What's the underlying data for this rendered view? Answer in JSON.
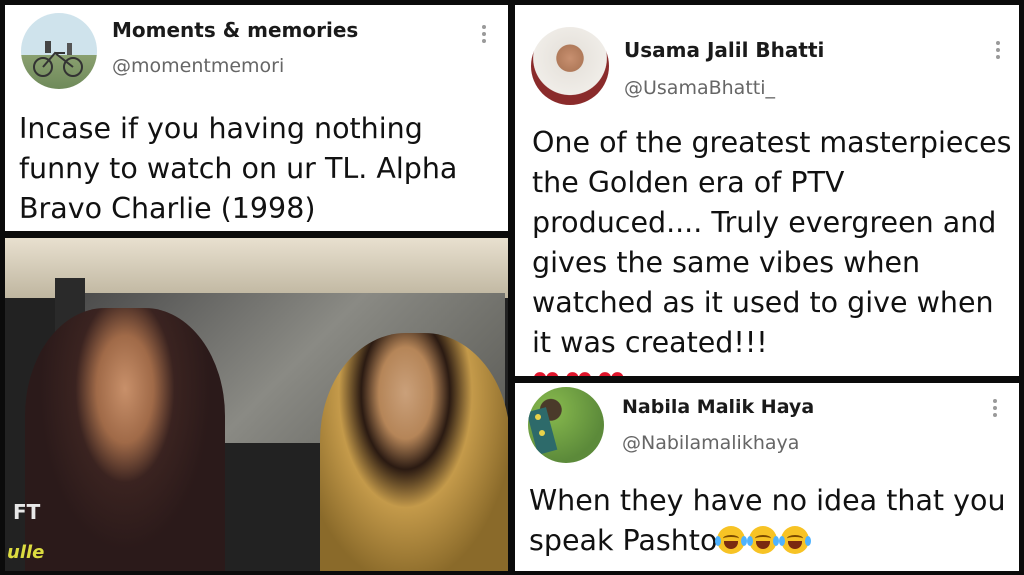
{
  "tweet1": {
    "name": "Moments & memories",
    "handle": "@momentmemori",
    "text": "Incase if you having nothing funny to watch on ur TL. Alpha Bravo Charlie (1998)"
  },
  "video": {
    "ft_label": "FT",
    "corner_logo": "ulle"
  },
  "tweet2": {
    "name": "Usama Jalil Bhatti",
    "handle": "@UsamaBhatti_",
    "text": "One of the greatest masterpieces the Golden era of PTV produced.... Truly evergreen and gives the same vibes when watched as it used to give when it was created!!!",
    "emoji": [
      "❤",
      "❤",
      "❤"
    ]
  },
  "tweet3": {
    "name": "Nabila Malik Haya",
    "handle": "@Nabilamalikhaya",
    "text": "When they have no idea that you speak Pashto",
    "emoji_count": 3,
    "emoji_name": "face-with-tears-of-joy-icon"
  },
  "colors": {
    "heart": "#e0142b",
    "handle": "#666666",
    "emoji": "#f7c325"
  }
}
